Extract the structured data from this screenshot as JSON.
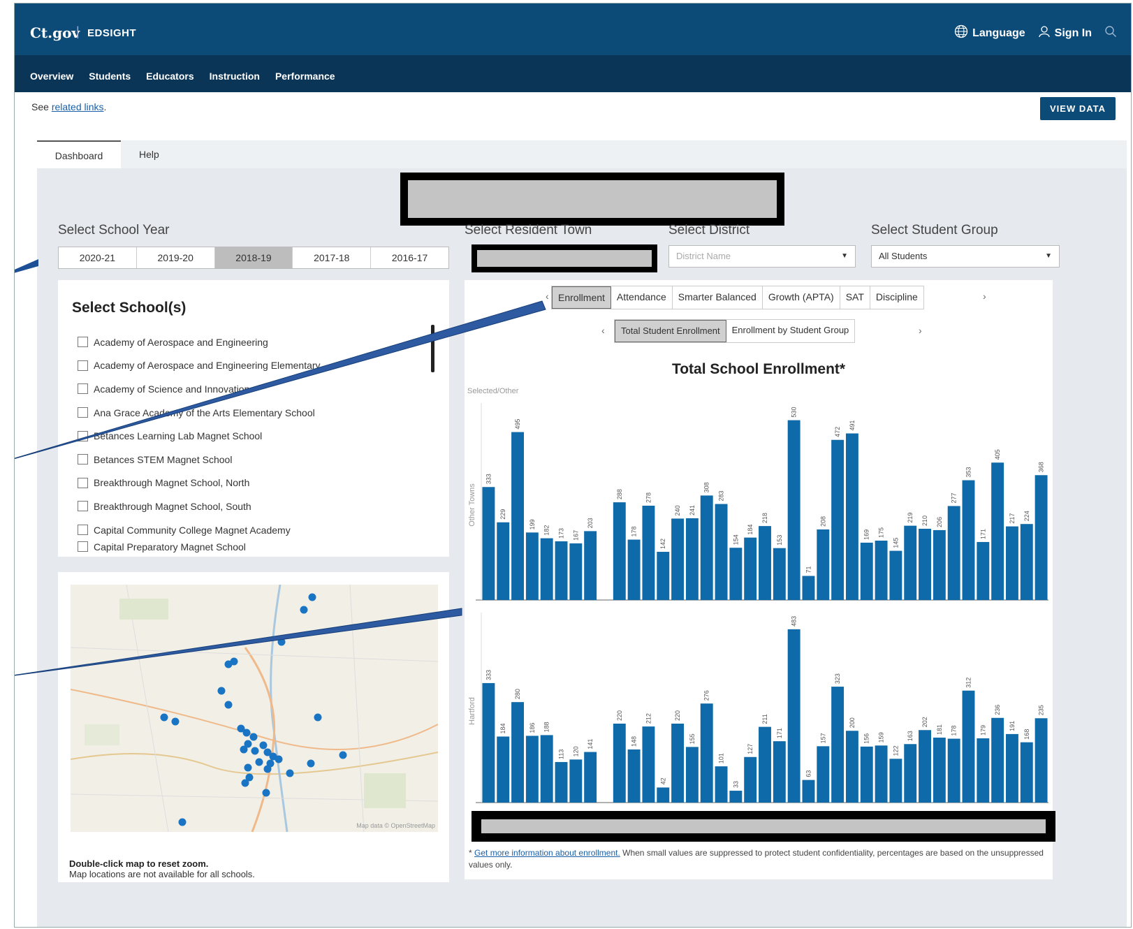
{
  "header": {
    "logo": "Ct.gov",
    "separator": "|",
    "brand": "EDSIGHT",
    "language": "Language",
    "sign_in": "Sign In"
  },
  "nav": {
    "items": [
      "Overview",
      "Students",
      "Educators",
      "Instruction",
      "Performance"
    ]
  },
  "related": {
    "prefix": "See ",
    "link": "related links",
    "suffix": "."
  },
  "view_data": "VIEW DATA",
  "tabs": {
    "dashboard": "Dashboard",
    "help": "Help"
  },
  "filters": {
    "school_year_label": "Select School Year",
    "years": [
      "2020-21",
      "2019-20",
      "2018-19",
      "2017-18",
      "2016-17"
    ],
    "selected_year": "2018-19",
    "town_label": "Select Resident Town",
    "district_label": "Select District",
    "district_placeholder": "District Name",
    "group_label": "Select Student Group",
    "group_value": "All Students"
  },
  "schools": {
    "title": "Select School(s)",
    "items": [
      "Academy of Aerospace and Engineering",
      "Academy of Aerospace and Engineering Elementary",
      "Academy of Science and Innovation",
      "Ana Grace Academy of the Arts Elementary School",
      "Betances Learning Lab Magnet School",
      "Betances STEM Magnet School",
      "Breakthrough Magnet School, North",
      "Breakthrough Magnet School, South",
      "Capital Community College Magnet Academy",
      "Capital Preparatory Magnet School"
    ]
  },
  "map": {
    "note_bold": "Double-click map to reset zoom.",
    "note": "Map locations are not available for all schools.",
    "credit": "Map data © OpenStreetMap"
  },
  "metric_tabs": [
    "Enrollment",
    "Attendance",
    "Smarter Balanced",
    "Growth (APTA)",
    "SAT",
    "Discipline"
  ],
  "metric_selected": "Enrollment",
  "view_tabs": [
    "Total Student Enrollment",
    "Enrollment by Student Group"
  ],
  "view_selected": "Total Student Enrollment",
  "chart_data": {
    "type": "bar",
    "title": "Total School Enrollment*",
    "legend_label": "Selected/Other",
    "grid": false,
    "series": [
      {
        "name": "Other Towns",
        "values": [
          333,
          229,
          495,
          199,
          182,
          173,
          167,
          203,
          null,
          288,
          178,
          278,
          142,
          240,
          241,
          308,
          283,
          154,
          184,
          218,
          153,
          530,
          71,
          208,
          472,
          491,
          169,
          175,
          145,
          219,
          210,
          206,
          277,
          353,
          171,
          405,
          217,
          224,
          368
        ]
      },
      {
        "name": "Hartford",
        "values": [
          333,
          184,
          280,
          186,
          188,
          113,
          120,
          141,
          null,
          220,
          148,
          212,
          42,
          220,
          155,
          276,
          101,
          33,
          127,
          211,
          171,
          483,
          63,
          157,
          323,
          200,
          156,
          159,
          122,
          163,
          202,
          181,
          178,
          312,
          179,
          236,
          191,
          168,
          235
        ]
      }
    ],
    "ylim_other": [
      0,
      560
    ],
    "ylim_hartford": [
      0,
      510
    ]
  },
  "footnote": {
    "star": "* ",
    "link": "Get more information about enrollment.",
    "text": " When small values are suppressed to protect student confidentiality, percentages are based on the unsuppressed values only."
  }
}
